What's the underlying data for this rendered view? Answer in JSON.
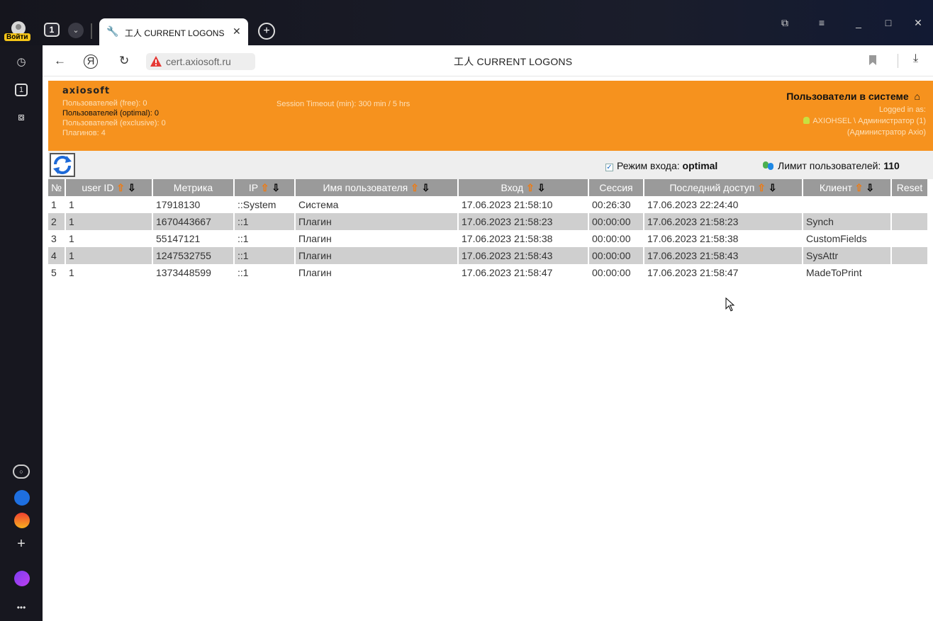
{
  "browser": {
    "login_label": "Войти",
    "tab_count": "1",
    "tab_title": "工人 CURRENT LOGONS",
    "url": "cert.axiosoft.ru",
    "page_title": "工人 CURRENT LOGONS"
  },
  "header": {
    "logo": "axiosoft",
    "stats": [
      "Пользователей (free): 0",
      "Пользователей (optimal): 0",
      "Пользователей (exclusive): 0",
      "Плагинов: 4"
    ],
    "timeout": "Session Timeout (min): 300 min  /  5 hrs",
    "title": "Пользователи в системе",
    "logged_in_label": "Logged in as:",
    "user_line": "AXIOHSEL \\ Администратор (1)",
    "user_fullname": "(Администратор Axio)"
  },
  "toolbar": {
    "mode_label": "Режим входа:",
    "mode_value": "optimal",
    "limit_label": "Лимит пользователей:",
    "limit_value": "110"
  },
  "table": {
    "headers": [
      "№",
      "user ID",
      "Метрика",
      "IP",
      "Имя пользователя",
      "Вход",
      "Сессия",
      "Последний доступ",
      "Клиент",
      "Reset"
    ],
    "rows": [
      [
        "1",
        "1",
        "17918130",
        "::System",
        "Система",
        "17.06.2023 21:58:10",
        "00:26:30",
        "17.06.2023 22:24:40",
        "",
        ""
      ],
      [
        "2",
        "1",
        "1670443667",
        "::1",
        "Плагин",
        "17.06.2023 21:58:23",
        "00:00:00",
        "17.06.2023 21:58:23",
        "Synch",
        ""
      ],
      [
        "3",
        "1",
        "55147121",
        "::1",
        "Плагин",
        "17.06.2023 21:58:38",
        "00:00:00",
        "17.06.2023 21:58:38",
        "CustomFields",
        ""
      ],
      [
        "4",
        "1",
        "1247532755",
        "::1",
        "Плагин",
        "17.06.2023 21:58:43",
        "00:00:00",
        "17.06.2023 21:58:43",
        "SysAttr",
        ""
      ],
      [
        "5",
        "1",
        "1373448599",
        "::1",
        "Плагин",
        "17.06.2023 21:58:47",
        "00:00:00",
        "17.06.2023 21:58:47",
        "MadeToPrint",
        ""
      ]
    ]
  }
}
